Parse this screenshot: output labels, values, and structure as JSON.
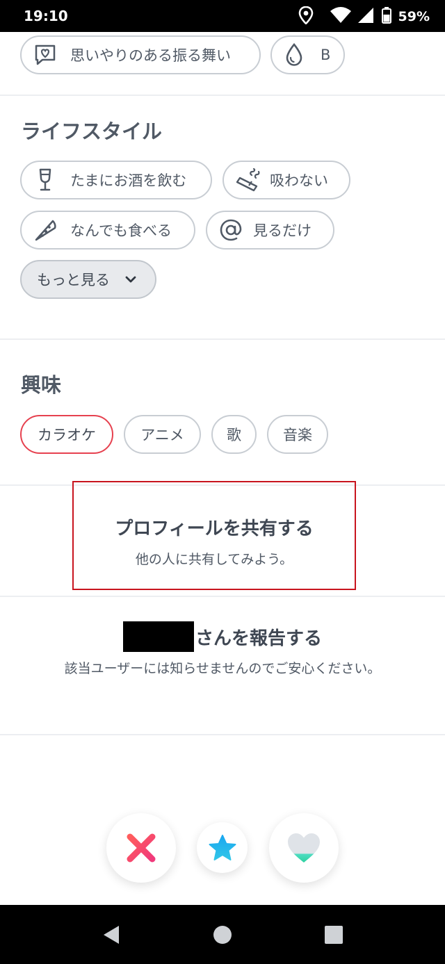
{
  "status_bar": {
    "time": "19:10",
    "battery": "59%",
    "icons": [
      "location-icon",
      "wifi-icon",
      "signal-icon",
      "battery-icon"
    ]
  },
  "top_chips": [
    {
      "label": "思いやりのある振る舞い",
      "icon": "heart-chat-icon"
    },
    {
      "label": "B",
      "icon": "drop-icon"
    }
  ],
  "lifestyle": {
    "title": "ライフスタイル",
    "chips": [
      {
        "label": "たまにお酒を飲む",
        "icon": "wine-glass-icon"
      },
      {
        "label": "吸わない",
        "icon": "cigarette-icon"
      },
      {
        "label": "なんでも食べる",
        "icon": "pizza-icon"
      },
      {
        "label": "見るだけ",
        "icon": "at-sign-icon"
      }
    ],
    "more_label": "もっと見る"
  },
  "interests": {
    "title": "興味",
    "chips": [
      "カラオケ",
      "アニメ",
      "歌",
      "音楽"
    ],
    "active": "カラオケ"
  },
  "share": {
    "title": "プロフィールを共有する",
    "subtitle": "他の人に共有してみよう。"
  },
  "report": {
    "title": "さんを報告する",
    "description": "該当ユーザーには知らせませんのでご安心ください。"
  },
  "actions": [
    {
      "name": "nope",
      "icon": "x-icon",
      "color": "#f0456a"
    },
    {
      "name": "super-like",
      "icon": "star-icon",
      "color": "#2fa8f0"
    },
    {
      "name": "like",
      "icon": "heart-icon",
      "color": "#3dd6a8"
    }
  ],
  "nav": [
    "back-icon",
    "home-icon",
    "recents-icon"
  ]
}
